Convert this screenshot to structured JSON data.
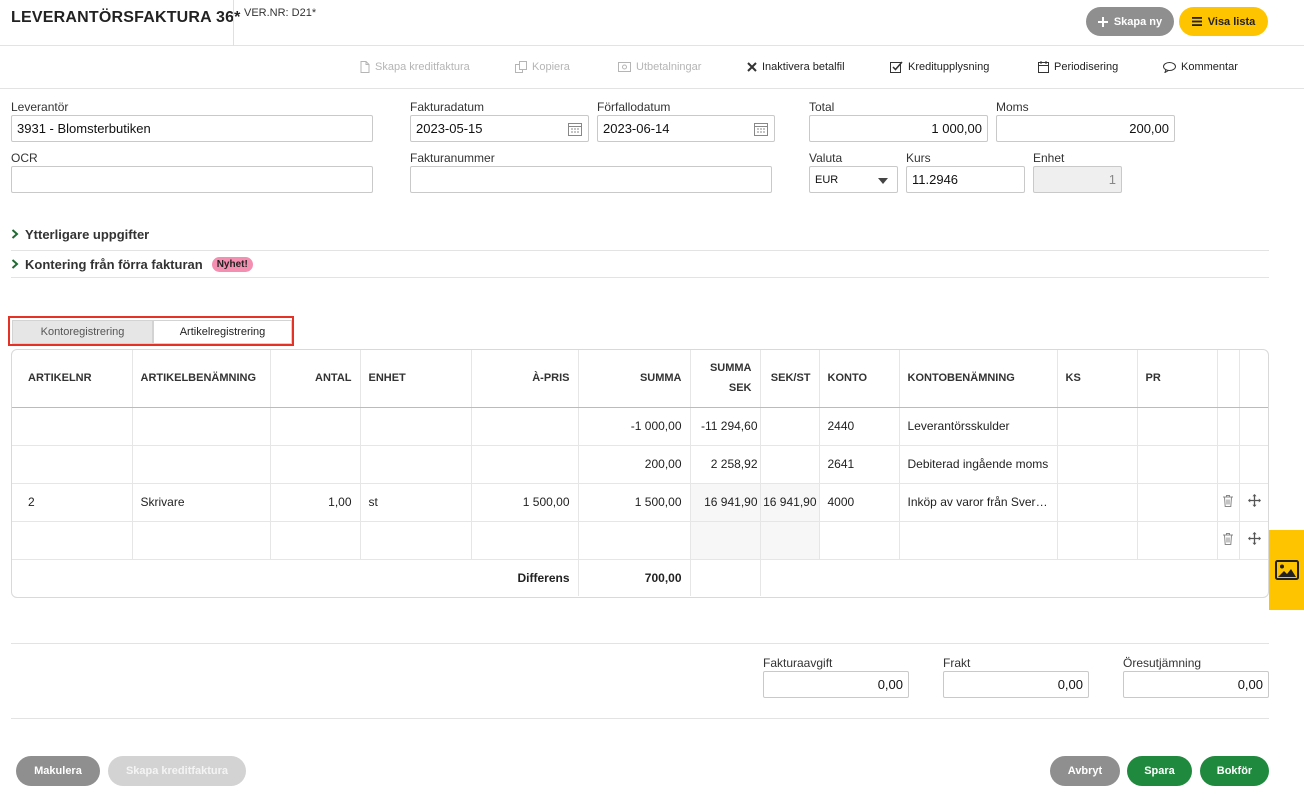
{
  "header": {
    "title": "LEVERANTÖRSFAKTURA 36*",
    "vernr": "VER.NR: D21*",
    "create_new_label": "Skapa ny",
    "show_list_label": "Visa lista"
  },
  "toolbar": {
    "items": [
      {
        "label": "Skapa kreditfaktura",
        "icon": "document-icon",
        "enabled": false
      },
      {
        "label": "Kopiera",
        "icon": "copy-icon",
        "enabled": false
      },
      {
        "label": "Utbetalningar",
        "icon": "money-icon",
        "enabled": false
      },
      {
        "label": "Inaktivera betalfil",
        "icon": "x-icon",
        "enabled": true
      },
      {
        "label": "Kreditupplysning",
        "icon": "checkbox-icon",
        "enabled": true
      },
      {
        "label": "Periodisering",
        "icon": "calendar-icon",
        "enabled": true
      },
      {
        "label": "Kommentar",
        "icon": "comment-icon",
        "enabled": true
      }
    ]
  },
  "form": {
    "leverantor_label": "Leverantör",
    "leverantor_value": "3931 - Blomsterbutiken",
    "fakturadatum_label": "Fakturadatum",
    "fakturadatum_value": "2023-05-15",
    "forfallodatum_label": "Förfallodatum",
    "forfallodatum_value": "2023-06-14",
    "total_label": "Total",
    "total_value": "1 000,00",
    "moms_label": "Moms",
    "moms_value": "200,00",
    "ocr_label": "OCR",
    "ocr_value": "",
    "fakturanummer_label": "Fakturanummer",
    "fakturanummer_value": "",
    "valuta_label": "Valuta",
    "valuta_value": "EUR",
    "kurs_label": "Kurs",
    "kurs_value": "11.2946",
    "enhet_label": "Enhet",
    "enhet_value": "1"
  },
  "sections": {
    "ytterligare": "Ytterligare uppgifter",
    "kontering": "Kontering från förra fakturan",
    "kontering_badge": "Nyhet!"
  },
  "tabs": {
    "kontoregistrering": "Kontoregistrering",
    "artikelregistrering": "Artikelregistrering"
  },
  "grid": {
    "headers": {
      "artikelnr": "ARTIKELNR",
      "artikelbenamning": "ARTIKELBENÄMNING",
      "antal": "ANTAL",
      "enhet": "ENHET",
      "apris": "À-PRIS",
      "summa": "SUMMA",
      "summa_sek_1": "SUMMA",
      "summa_sek_2": "SEK",
      "sek_st": "SEK/ST",
      "konto": "KONTO",
      "kontobenamning": "KONTOBENÄMNING",
      "ks": "KS",
      "pr": "PR"
    },
    "rows": [
      {
        "artikelnr": "",
        "benamning": "",
        "antal": "",
        "enhet": "",
        "apris": "",
        "summa": "-1 000,00",
        "summa_sek": "-11 294,60",
        "sek_st": "",
        "konto": "2440",
        "kontobenamning": "Leverantörsskulder",
        "ks": "",
        "pr": ""
      },
      {
        "artikelnr": "",
        "benamning": "",
        "antal": "",
        "enhet": "",
        "apris": "",
        "summa": "200,00",
        "summa_sek": "2 258,92",
        "sek_st": "",
        "konto": "2641",
        "kontobenamning": "Debiterad ingående moms",
        "ks": "",
        "pr": ""
      },
      {
        "artikelnr": "2",
        "benamning": "Skrivare",
        "antal": "1,00",
        "enhet": "st",
        "apris": "1 500,00",
        "summa": "1 500,00",
        "summa_sek": "16 941,90",
        "sek_st": "16 941,90",
        "konto": "4000",
        "kontobenamning": "Inköp av varor från Sveri…",
        "ks": "",
        "pr": ""
      },
      {
        "artikelnr": "",
        "benamning": "",
        "antal": "",
        "enhet": "",
        "apris": "",
        "summa": "",
        "summa_sek": "",
        "sek_st": "",
        "konto": "",
        "kontobenamning": "",
        "ks": "",
        "pr": ""
      }
    ],
    "differens_label": "Differens",
    "differens_value": "700,00"
  },
  "fees": {
    "fakturaavgift_label": "Fakturaavgift",
    "fakturaavgift_value": "0,00",
    "frakt_label": "Frakt",
    "frakt_value": "0,00",
    "oresutjamning_label": "Öresutjämning",
    "oresutjamning_value": "0,00"
  },
  "footer": {
    "makulera": "Makulera",
    "skapa_kreditfaktura": "Skapa kreditfaktura",
    "avbryt": "Avbryt",
    "spara": "Spara",
    "bokfor": "Bokför"
  },
  "colors": {
    "accent_yellow": "#ffc400",
    "primary_green": "#1f8a3e",
    "highlight_red": "#e53226",
    "badge_pink": "#f48fb1"
  }
}
